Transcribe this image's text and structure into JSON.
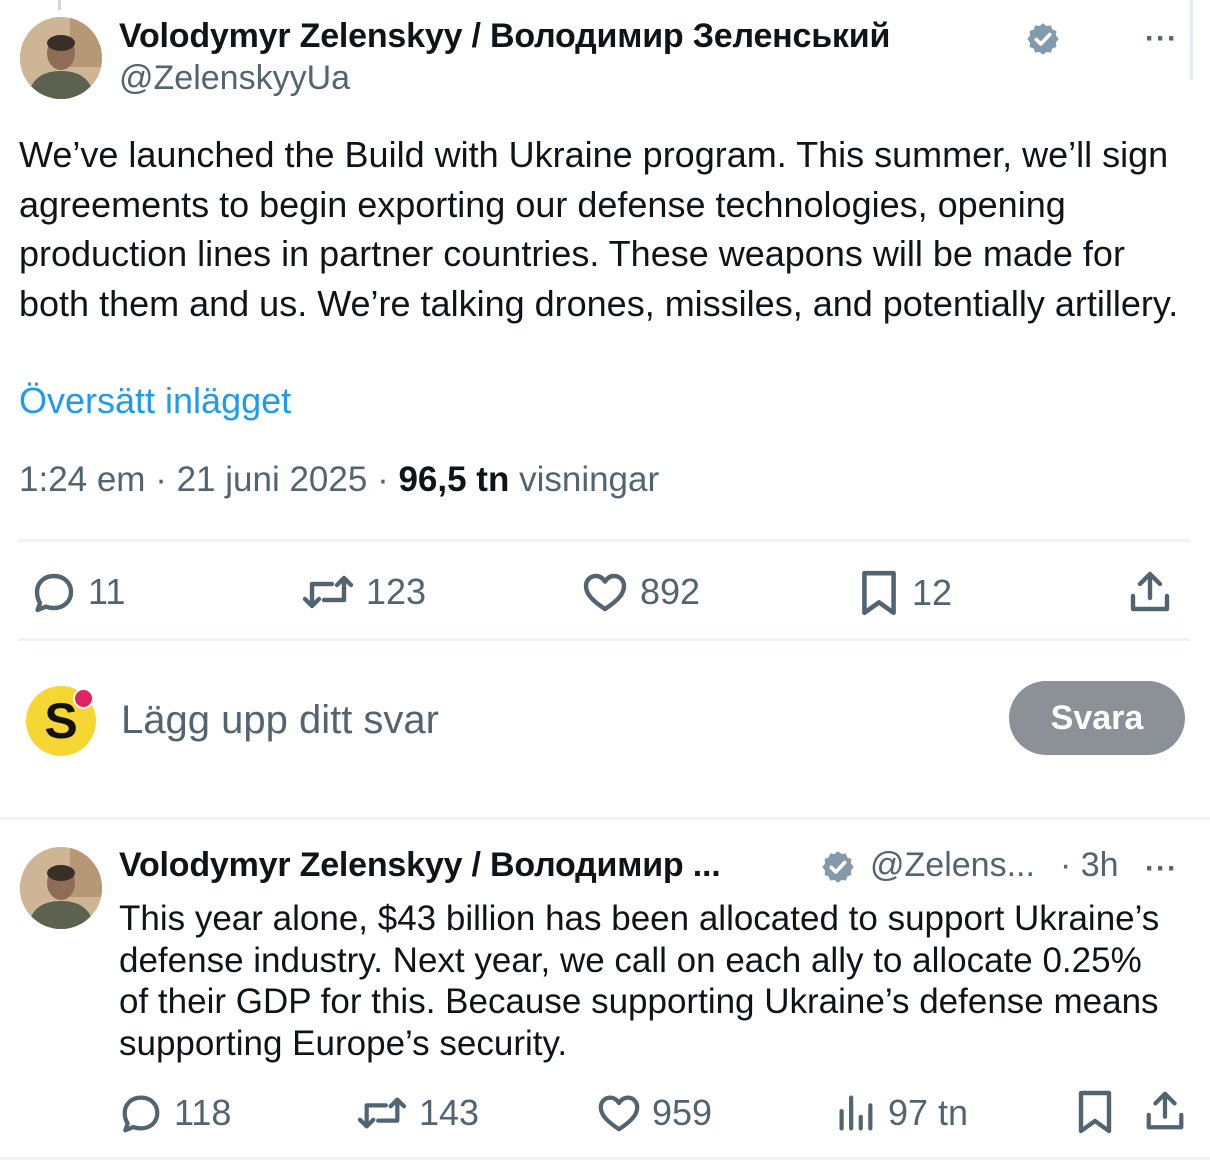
{
  "main_post": {
    "author_name": "Volodymyr Zelenskyy / Володимир Зеленський",
    "handle": "@ZelenskyyUa",
    "text": "We’ve launched the Build with Ukraine program. This summer, we’ll sign agreements to begin exporting our defense technologies, opening production lines in partner countries. These weapons will be made for both them and us. We’re talking drones, missiles, and potentially artillery.",
    "translate_label": "Översätt inlägget",
    "time": "1:24 em",
    "date": "21 juni 2025",
    "views_count": "96,5 tn",
    "views_label": "visningar",
    "more_label": "···",
    "stats": {
      "replies": "11",
      "reposts": "123",
      "likes": "892",
      "bookmarks": "12"
    }
  },
  "reply_box": {
    "avatar_letter": "S",
    "placeholder": "Lägg upp ditt svar",
    "button_label": "Svara"
  },
  "thread_post": {
    "author_name": "Volodymyr Zelenskyy / Володимир ...",
    "handle": "@Zelens...",
    "time": "· 3h",
    "more_label": "···",
    "text": "This year alone, $43 billion has been allocated to support Ukraine’s defense industry. Next year, we call on each ally to allocate 0.25% of their GDP for this. Because supporting Ukraine’s defense means supporting Europe’s security.",
    "stats": {
      "replies": "118",
      "reposts": "143",
      "likes": "959",
      "views": "97 tn"
    }
  },
  "colors": {
    "link": "#1d9bf0",
    "muted": "#536471",
    "text": "#0f1419",
    "verified": "#829aab",
    "button_disabled": "#8b9196"
  },
  "icons": [
    "avatar",
    "verified-badge-icon",
    "more-icon",
    "reply-icon",
    "repost-icon",
    "like-icon",
    "bookmark-icon",
    "share-icon",
    "views-icon"
  ]
}
